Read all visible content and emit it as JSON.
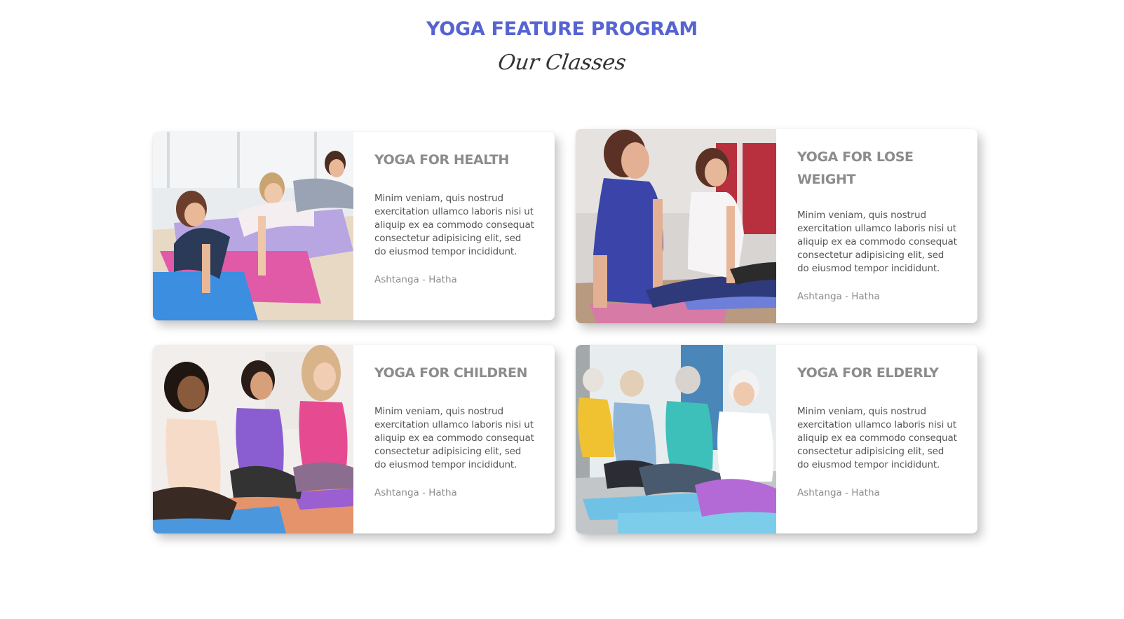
{
  "header": {
    "title": "YOGA FEATURE PROGRAM",
    "subtitle": "Our Classes"
  },
  "colors": {
    "accent": "#5664d2",
    "card_title": "#8c8c8c",
    "card_text": "#555555",
    "card_tags": "#8c8c8c",
    "background": "#ffffff"
  },
  "classes": [
    {
      "title": "YOGA FOR HEALTH",
      "description": "Minim veniam, quis nostrud exercitation ullamco laboris nisi ut aliquip ex ea commodo consequat consectetur adipisicing elit, sed do eiusmod tempor incididunt.",
      "tags": "Ashtanga - Hatha",
      "image": "women-plank-pose-on-yoga-mats"
    },
    {
      "title": "YOGA FOR LOSE WEIGHT",
      "description": "Minim veniam, quis nostrud exercitation ullamco laboris nisi ut aliquip ex ea commodo consequat consectetur adipisicing elit, sed do eiusmod tempor incididunt.",
      "tags": "Ashtanga - Hatha",
      "image": "women-cobra-pose-in-studio"
    },
    {
      "title": "YOGA FOR CHILDREN",
      "description": "Minim veniam, quis nostrud exercitation ullamco laboris nisi ut aliquip ex ea commodo consequat consectetur adipisicing elit, sed do eiusmod tempor incididunt.",
      "tags": "Ashtanga - Hatha",
      "image": "girls-meditating-cross-legged"
    },
    {
      "title": "YOGA FOR ELDERLY",
      "description": "Minim veniam, quis nostrud exercitation ullamco laboris nisi ut aliquip ex ea commodo consequat consectetur adipisicing elit, sed do eiusmod tempor incididunt.",
      "tags": "Ashtanga - Hatha",
      "image": "seniors-praying-hands-pose"
    }
  ]
}
